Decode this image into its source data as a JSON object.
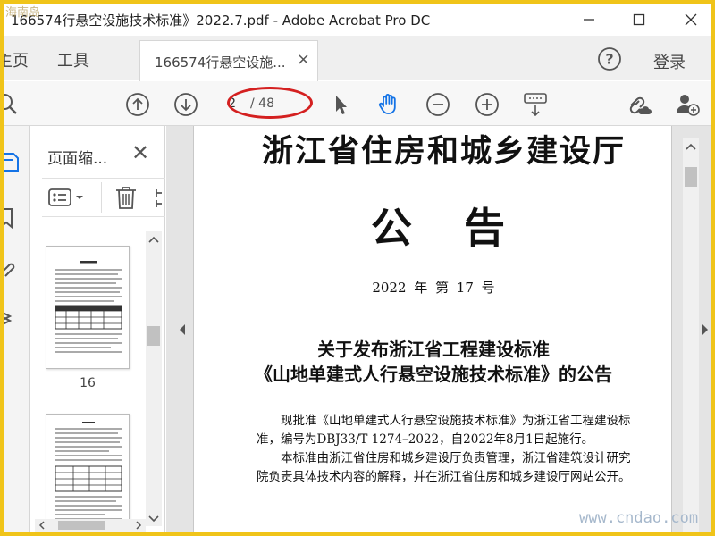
{
  "window": {
    "title": "166574行悬空设施技术标准》2022.7.pdf - Adobe Acrobat Pro DC",
    "corner_mark": "海南岛"
  },
  "menubar": {
    "home": "主页",
    "tools": "工具",
    "doc_tab": "166574行悬空设施...",
    "login": "登录"
  },
  "toolbar": {
    "page_current": "2",
    "page_total": "/ 48"
  },
  "panel": {
    "title": "页面缩...",
    "thumbs": [
      {
        "label": "16"
      },
      {
        "label": ""
      }
    ]
  },
  "document": {
    "department": "浙江省住房和城乡建设厅",
    "notice": "公告",
    "issue": "2022 年 第 17 号",
    "heading_line1": "关于发布浙江省工程建设标准",
    "heading_line2": "《山地单建式人行悬空设施技术标准》的公告",
    "para1": "现批准《山地单建式人行悬空设施技术标准》为浙江省工程建设标准，编号为DBJ33/T 1274–2022，自2022年8月1日起施行。",
    "para2": "本标准由浙江省住房和城乡建设厅负责管理，浙江省建筑设计研究院负责具体技术内容的解释，并在浙江省住房和城乡建设厅网站公开。"
  },
  "watermark": "www.cndao.com",
  "colors": {
    "frame": "#f0c419",
    "annotation_ellipse": "#d42020",
    "hand_tool_active": "#1473e6"
  }
}
